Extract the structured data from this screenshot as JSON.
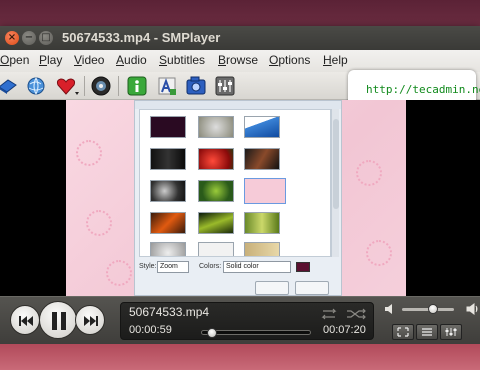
{
  "window": {
    "title": "50674533.mp4 - SMPlayer",
    "buttons": {
      "close": "×",
      "minimize": "−",
      "maximize": "□"
    }
  },
  "menu": {
    "items": [
      {
        "mnemonic": "O",
        "rest": "pen"
      },
      {
        "mnemonic": "P",
        "rest": "lay"
      },
      {
        "mnemonic": "V",
        "rest": "ideo"
      },
      {
        "mnemonic": "A",
        "rest": "udio"
      },
      {
        "mnemonic": "S",
        "rest": "ubtitles"
      },
      {
        "mnemonic": "B",
        "rest": "rowse"
      },
      {
        "mnemonic": "O",
        "rest": "ptions",
        "pre": ""
      },
      {
        "mnemonic": "H",
        "rest": "elp"
      }
    ]
  },
  "toolbar": {
    "icons": [
      "open-file-icon",
      "open-url-icon",
      "favorites-icon",
      "disc-icon",
      "info-icon",
      "subtitles-icon",
      "screenshot-icon",
      "equalizer-icon"
    ]
  },
  "callout": {
    "text": "http://tecadmin.net"
  },
  "dialog": {
    "style_label": "Style:",
    "style_value": "Zoom",
    "colors_label": "Colors:",
    "colors_value": "Solid color"
  },
  "player": {
    "filename": "50674533.mp4",
    "elapsed": "00:00:59",
    "total": "00:07:20",
    "progress": 0.09,
    "volume": 0.6
  },
  "colors": {
    "titlebar": "#3c3b37",
    "close_button": "#df4b16",
    "callout_link": "#118a1c",
    "video_bg": "#f2c6d4"
  }
}
